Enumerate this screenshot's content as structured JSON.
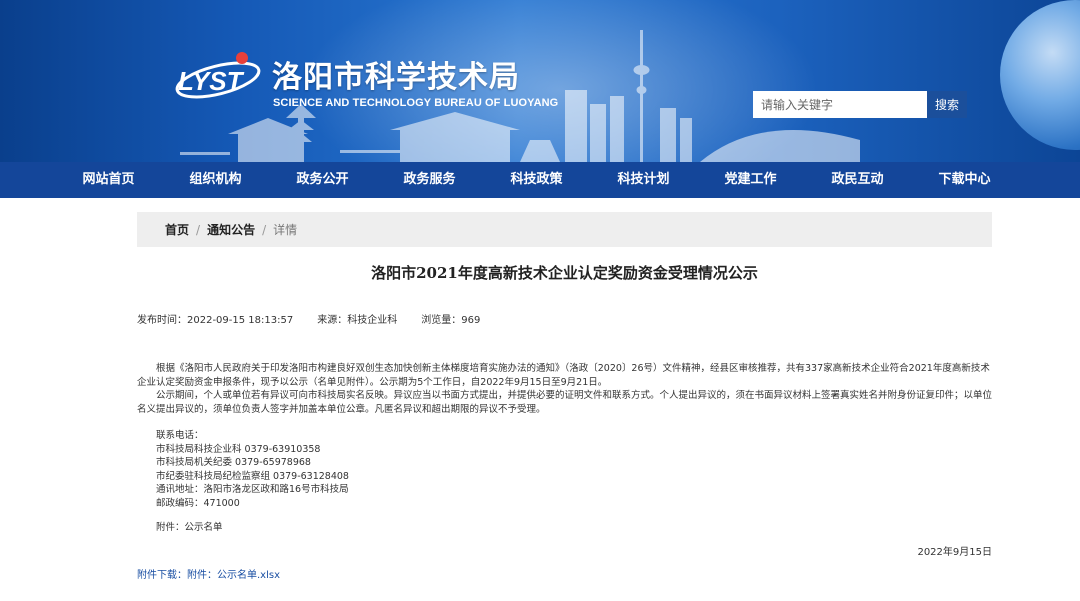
{
  "header": {
    "logo_text": "LYST",
    "title": "洛阳市科学技术局",
    "subtitle": "SCIENCE AND TECHNOLOGY BUREAU OF LUOYANG"
  },
  "search": {
    "placeholder": "请输入关键字",
    "button_label": "搜索"
  },
  "nav": {
    "items": [
      "网站首页",
      "组织机构",
      "政务公开",
      "政务服务",
      "科技政策",
      "科技计划",
      "党建工作",
      "政民互动",
      "下载中心"
    ]
  },
  "breadcrumb": {
    "home": "首页",
    "section": "通知公告",
    "separator": "/",
    "current": "详情"
  },
  "article": {
    "title": "洛阳市2021年度高新技术企业认定奖励资金受理情况公示",
    "meta": {
      "publish_label": "发布时间：",
      "publish_time": "2022-09-15 18:13:57",
      "source_label": "来源：",
      "source": "科技企业科",
      "views_label": "浏览量：",
      "views": "969"
    },
    "paragraphs": [
      "根据《洛阳市人民政府关于印发洛阳市构建良好双创生态加快创新主体梯度培育实施办法的通知》（洛政〔2020〕26号）文件精神，经县区审核推荐，共有337家高新技术企业符合2021年度高新技术企业认定奖励资金申报条件，现予以公示（名单见附件）。公示期为5个工作日，自2022年9月15日至9月21日。",
      "公示期间，个人或单位若有异议可向市科技局实名反映。异议应当以书面方式提出，并提供必要的证明文件和联系方式。个人提出异议的，须在书面异议材料上签署真实姓名并附身份证复印件；以单位名义提出异议的，须单位负责人签字并加盖本单位公章。凡匿名异议和超出期限的异议不予受理。"
    ],
    "contacts": [
      "联系电话：",
      "市科技局科技企业科 0379-63910358",
      "市科技局机关纪委 0379-65978968",
      "市纪委驻科技局纪检监察组 0379-63128408",
      "通讯地址：洛阳市洛龙区政和路16号市科技局",
      "邮政编码：471000"
    ],
    "attachment_note": "附件：公示名单",
    "date_signed": "2022年9月15日",
    "download": {
      "label": "附件下载：",
      "link_text": "附件：公示名单.xlsx"
    }
  },
  "colors": {
    "nav_bg": "#14469a",
    "header_blue": "#1559b6",
    "link": "#1a4fa3",
    "breadcrumb_bg": "#eeeeee"
  }
}
